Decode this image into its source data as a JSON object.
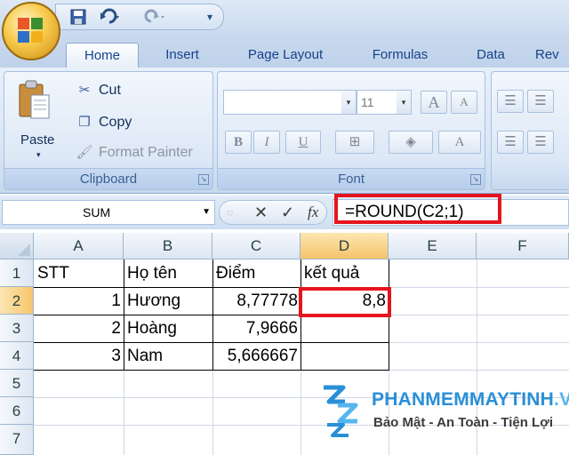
{
  "qat": {
    "icons": [
      "save-icon",
      "undo-icon",
      "redo-icon",
      "customize-qat-icon"
    ]
  },
  "tabs": [
    {
      "label": "Home",
      "active": true
    },
    {
      "label": "Insert",
      "active": false
    },
    {
      "label": "Page Layout",
      "active": false
    },
    {
      "label": "Formulas",
      "active": false
    },
    {
      "label": "Data",
      "active": false
    },
    {
      "label": "Rev",
      "active": false
    }
  ],
  "ribbon": {
    "clipboard": {
      "paste_label": "Paste",
      "cut_label": "Cut",
      "copy_label": "Copy",
      "format_painter_label": "Format Painter",
      "group_label": "Clipboard"
    },
    "font": {
      "font_name": "",
      "font_size": "11",
      "bold": "B",
      "italic": "I",
      "underline": "U",
      "grow": "A",
      "shrink": "A",
      "font_color": "A",
      "group_label": "Font"
    }
  },
  "formula_bar": {
    "name_box": "SUM",
    "cancel": "✕",
    "enter": "✓",
    "fx": "fx",
    "formula": "=ROUND(C2;1)"
  },
  "sheet": {
    "columns": [
      "A",
      "B",
      "C",
      "D",
      "E",
      "F"
    ],
    "rows": [
      "1",
      "2",
      "3",
      "4",
      "5",
      "6",
      "7"
    ],
    "cells": {
      "A1": "STT",
      "B1": "Họ tên",
      "C1": "Điểm",
      "D1": "kết quả",
      "A2": "1",
      "B2": "Hương",
      "C2": "8,77778",
      "D2": "8,8",
      "A3": "2",
      "B3": "Hoàng",
      "C3": "7,9666",
      "A4": "3",
      "B4": "Nam",
      "C4": "5,666667"
    }
  },
  "watermark": {
    "title_main": "PHANMEMMAYTINH",
    "title_ext": ".VN",
    "subtitle": "Bảo Mật - An Toàn - Tiện Lợi"
  },
  "colors": {
    "highlight": "#e5141d",
    "ribbon_text": "#15428b",
    "watermark_blue": "#2a8fd6"
  }
}
